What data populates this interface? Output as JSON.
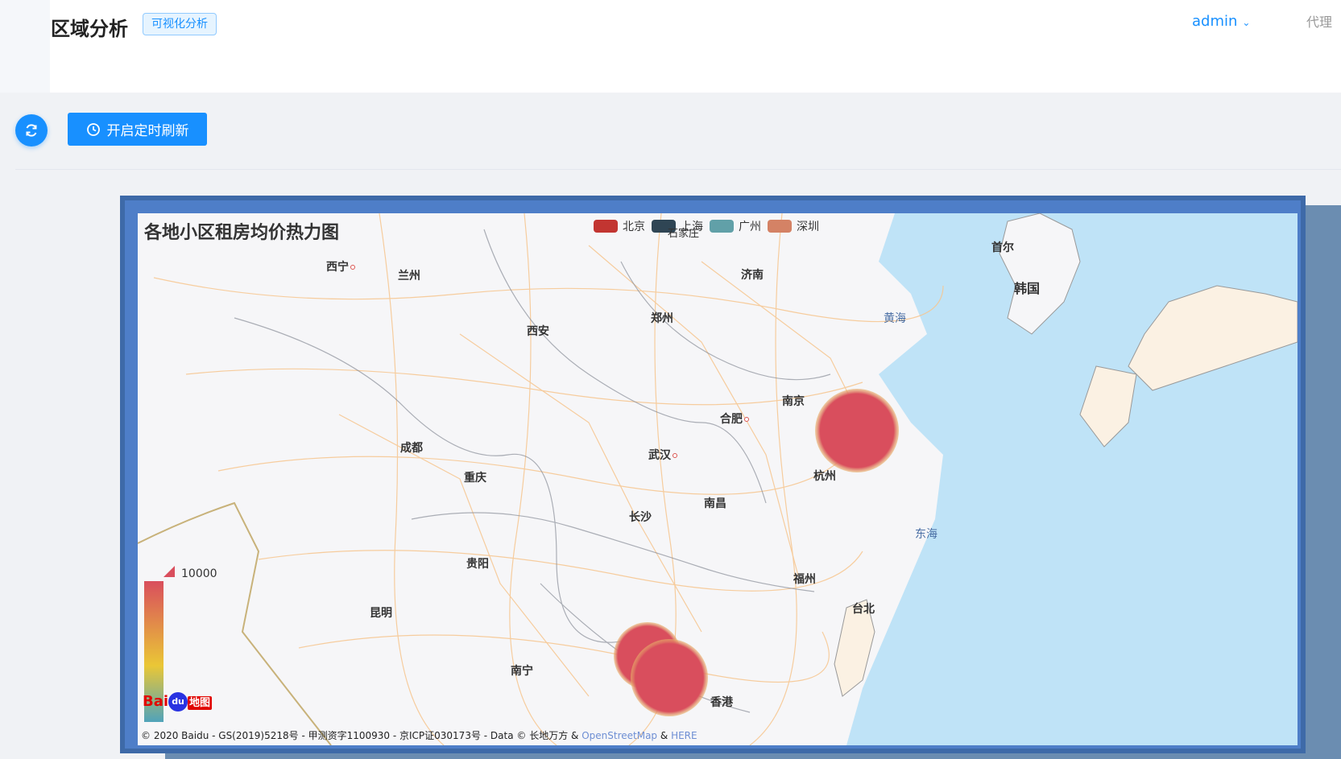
{
  "header": {
    "title": "区域分析",
    "tag": "可视化分析",
    "user": "admin",
    "agent_text": "代理"
  },
  "toolbar": {
    "refresh_icon": "refresh-icon",
    "timer_icon": "clock-icon",
    "timer_label": "开启定时刷新"
  },
  "map": {
    "title": "各地小区租房均价热力图",
    "legend": [
      {
        "name": "北京",
        "color": "#c23531"
      },
      {
        "name": "上海",
        "color": "#2f4554"
      },
      {
        "name": "广州",
        "color": "#61a0a8"
      },
      {
        "name": "深圳",
        "color": "#d48265"
      }
    ],
    "visual_map_max": "10000",
    "visual_map_colors": [
      "#d94e5d",
      "#eac736",
      "#50a3ba"
    ],
    "cities": [
      "西宁",
      "兰州",
      "济南",
      "西安",
      "郑州",
      "南京",
      "合肥",
      "成都",
      "武汉",
      "杭州",
      "重庆",
      "长沙",
      "南昌",
      "贵阳",
      "福州",
      "昆明",
      "台北",
      "南宁",
      "香港",
      "首尔",
      "韩国",
      "石家庄"
    ],
    "seas": [
      "黄海",
      "东海"
    ],
    "baidu_logo": {
      "bai": "Bai",
      "du": "du",
      "di": "地图"
    },
    "copyright": "© 2020 Baidu - GS(2019)5218号 - 甲测资字1100930 - 京ICP证030173号 - Data © 长地万方 &",
    "osm": "OpenStreetMap",
    "and": "&",
    "here": "HERE"
  }
}
